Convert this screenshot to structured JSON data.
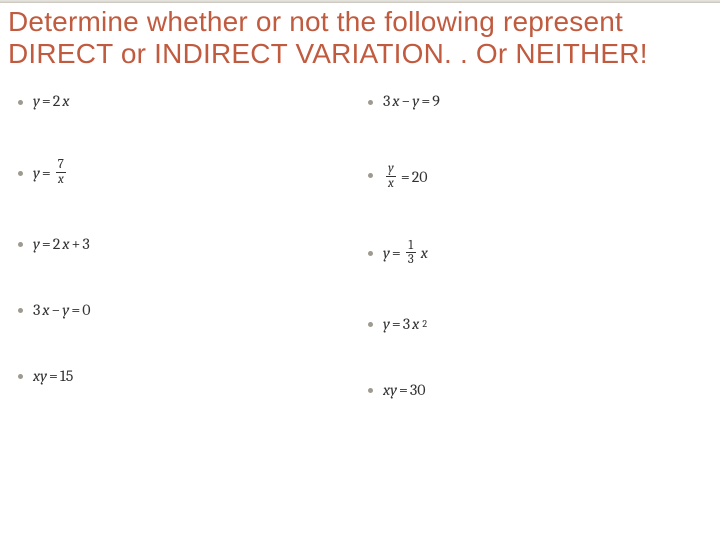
{
  "title": "Determine whether or not the following represent DIRECT or INDIRECT VARIATION. . Or NEITHER!",
  "left": {
    "items": [
      {
        "html": "<span class='eq'>y <span class='n'>=</span> <span class='n'>2</span> x</span>"
      },
      {
        "html": "<span class='eq'>y <span class='n'>=</span> <span class='frac'><span class='num n'>7</span><span class='den'>x</span></span></span>"
      },
      {
        "html": "<span class='eq'>y <span class='n'>=</span> <span class='n'>2</span> x <span class='n'>+</span> <span class='n'>3</span></span>"
      },
      {
        "html": "<span class='eq'><span class='n'>3</span> x <span class='n'>−</span> y <span class='n'>=</span> <span class='n'>0</span></span>"
      },
      {
        "html": "<span class='eq'>xy <span class='n'>=</span> <span class='n'>15</span></span>"
      }
    ]
  },
  "right": {
    "items": [
      {
        "html": "<span class='eq'><span class='n'>3</span> x <span class='n'>−</span> y <span class='n'>=</span> <span class='n'>9</span></span>"
      },
      {
        "html": "<span class='eq'><span class='frac'><span class='num'>y</span><span class='den'>x</span></span> <span class='n'>=</span> <span class='n'>20</span></span>"
      },
      {
        "html": "<span class='eq'>y <span class='n'>=</span> <span class='frac'><span class='num n'>1</span><span class='den n'>3</span></span> x</span>"
      },
      {
        "html": "<span class='eq'>y <span class='n'>=</span> <span class='n'>3</span>x<span class='sup'>2</span></span>"
      },
      {
        "html": "<span class='eq'>xy <span class='n'>=</span> <span class='n'>30</span></span>"
      }
    ]
  }
}
